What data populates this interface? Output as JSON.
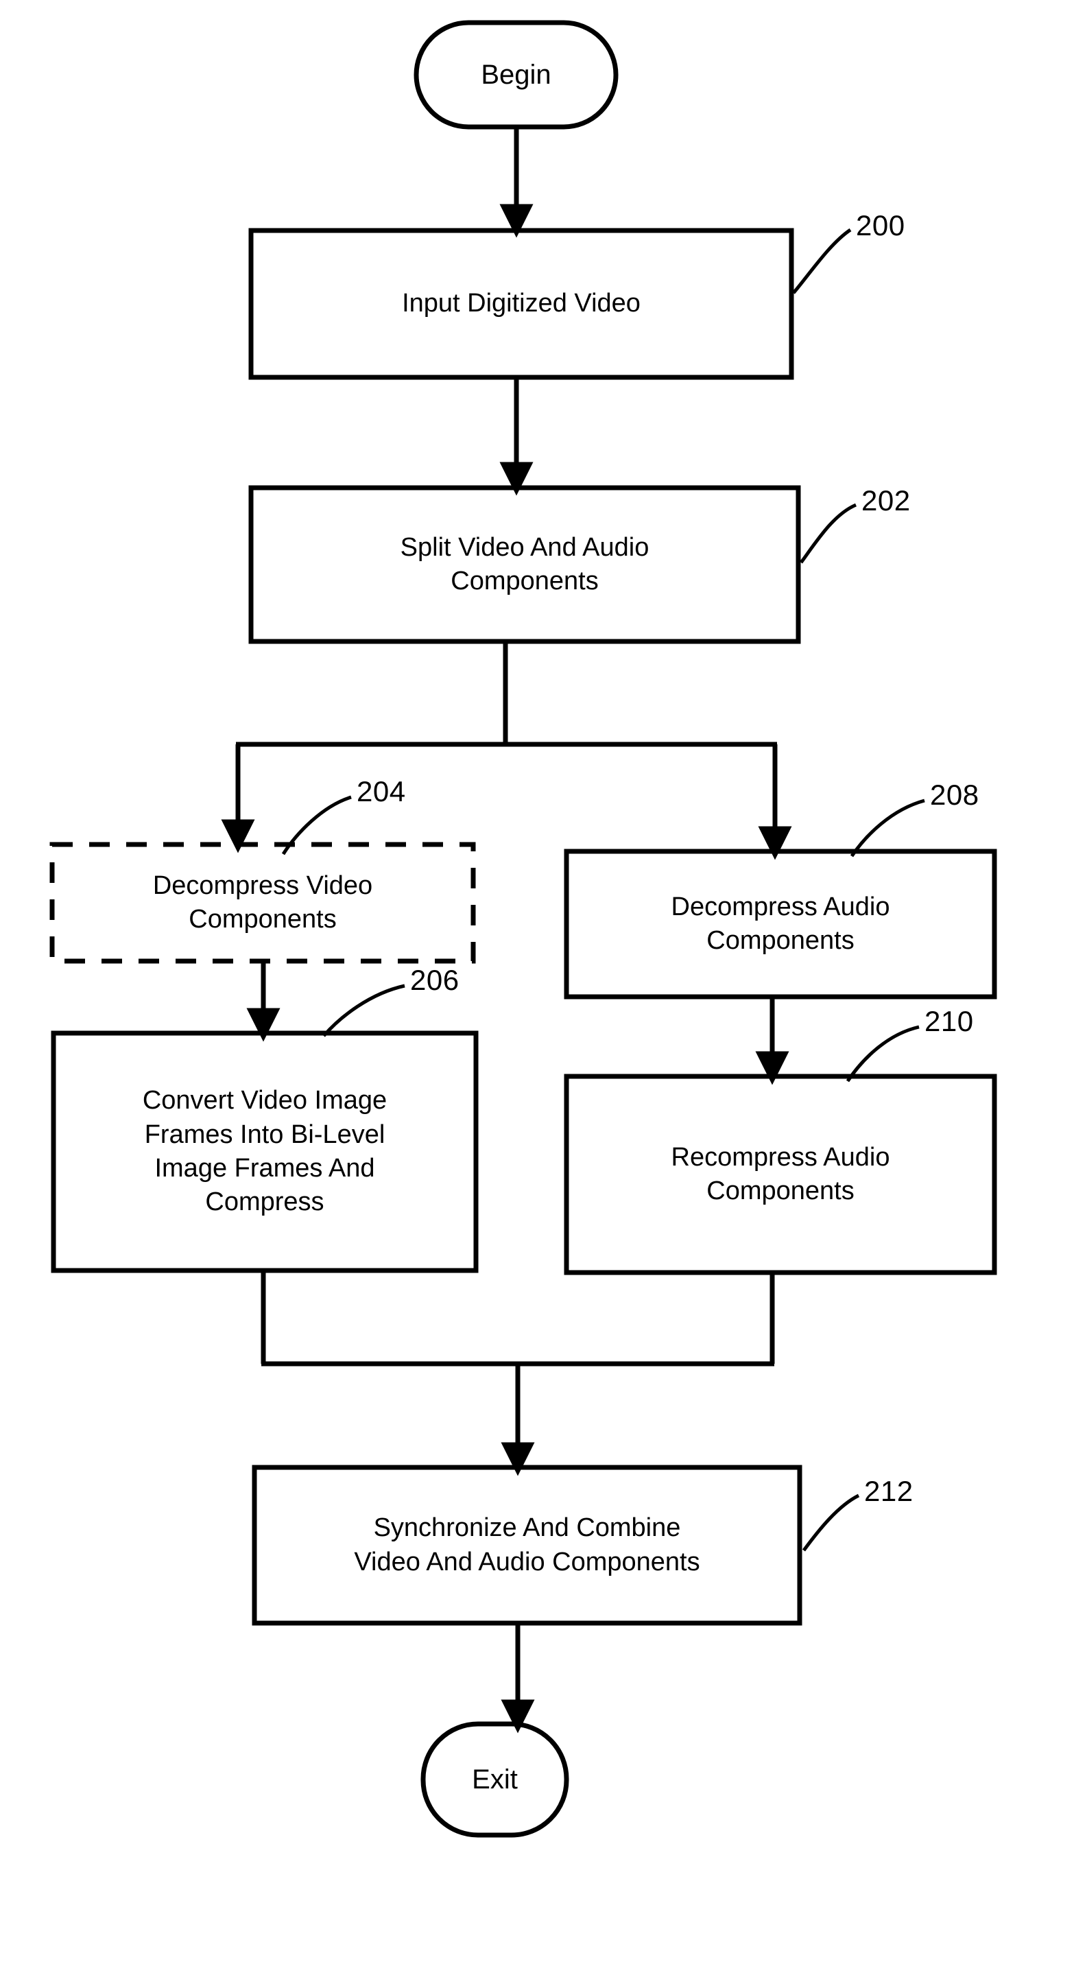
{
  "figure": {
    "type": "process-flowchart",
    "title": "Video and audio digitization process flow"
  },
  "nodes": {
    "begin": {
      "label": "Begin",
      "shape": "terminator"
    },
    "input_digitized_video": {
      "label": "Input Digitized Video",
      "shape": "process",
      "ref": "200"
    },
    "split_video_audio": {
      "label": "Split Video And Audio\nComponents",
      "shape": "process",
      "ref": "202"
    },
    "decompress_video": {
      "label": "Decompress Video\nComponents",
      "shape": "process-optional-dashed",
      "ref": "204"
    },
    "decompress_audio": {
      "label": "Decompress Audio\nComponents",
      "shape": "process",
      "ref": "208"
    },
    "convert_bilevel": {
      "label": "Convert Video Image\nFrames Into Bi-Level\nImage Frames And\nCompress",
      "shape": "process",
      "ref": "206"
    },
    "recompress_audio": {
      "label": "Recompress Audio\nComponents",
      "shape": "process",
      "ref": "210"
    },
    "synchronize_combine": {
      "label": "Synchronize And Combine\nVideo And Audio Components",
      "shape": "process",
      "ref": "212"
    },
    "exit": {
      "label": "Exit",
      "shape": "terminator"
    }
  },
  "reference_numerals": {
    "n200": "200",
    "n202": "202",
    "n204": "204",
    "n206": "206",
    "n208": "208",
    "n210": "210",
    "n212": "212"
  },
  "colors": {
    "stroke": "#000000",
    "fill": "#ffffff",
    "text": "#000000"
  }
}
